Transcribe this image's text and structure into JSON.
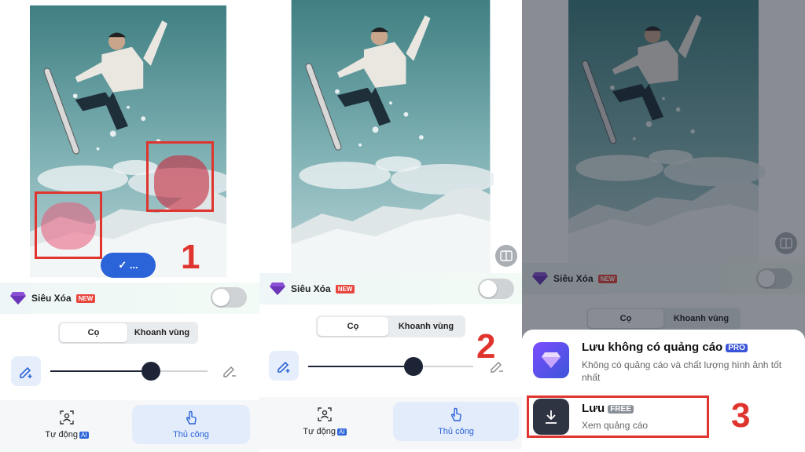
{
  "feature": {
    "label": "Siêu Xóa",
    "badge": "NEW"
  },
  "mode_tabs": {
    "brush": "Cọ",
    "region": "Khoanh vùng"
  },
  "bottom_tabs": {
    "auto": "Tự động",
    "ai_badge": "AI",
    "manual": "Thủ công"
  },
  "confirm_button": "✓ ...",
  "steps": {
    "one": "1",
    "two": "2",
    "three": "3"
  },
  "brush_size_level": 0.65,
  "save_sheet": {
    "no_ads_title": "Lưu không có quảng cáo",
    "no_ads_badge": "PRO",
    "no_ads_desc": "Không có quảng cáo và chất lượng hình ảnh tốt nhất",
    "save_title": "Lưu",
    "save_badge": "FREE",
    "save_desc": "Xem quảng cáo"
  },
  "colors": {
    "accent": "#2b63d9",
    "highlight": "#e0342f",
    "slider": "#1c2436"
  }
}
